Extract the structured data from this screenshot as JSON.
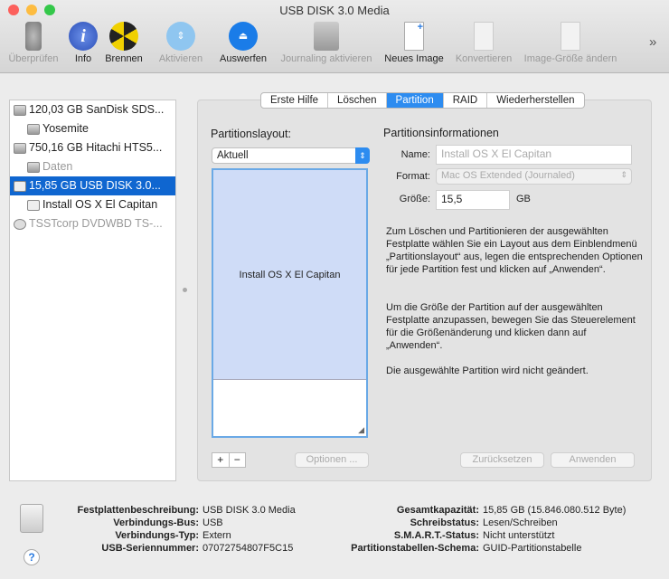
{
  "window": {
    "title": "USB DISK 3.0 Media"
  },
  "toolbar": {
    "items": [
      {
        "label": "Überprüfen",
        "icon": "microscope-icon",
        "enabled": false
      },
      {
        "label": "Info",
        "icon": "info-icon",
        "enabled": true
      },
      {
        "label": "Brennen",
        "icon": "burn-icon",
        "enabled": true
      },
      {
        "label": "Aktivieren",
        "icon": "mount-icon",
        "enabled": false
      },
      {
        "label": "Auswerfen",
        "icon": "eject-icon",
        "enabled": true
      },
      {
        "label": "Journaling aktivieren",
        "icon": "journaling-icon",
        "enabled": false
      },
      {
        "label": "Neues Image",
        "icon": "new-image-icon",
        "enabled": true
      },
      {
        "label": "Konvertieren",
        "icon": "convert-icon",
        "enabled": false
      },
      {
        "label": "Image-Größe ändern",
        "icon": "resize-image-icon",
        "enabled": false
      }
    ],
    "overflow": "»"
  },
  "sidebar": {
    "items": [
      {
        "label": "120,03 GB SanDisk SDS...",
        "level": 0
      },
      {
        "label": "Yosemite",
        "level": 1
      },
      {
        "label": "750,16 GB Hitachi HTS5...",
        "level": 0
      },
      {
        "label": "Daten",
        "level": 1
      },
      {
        "label": "15,85 GB USB DISK 3.0...",
        "level": 0,
        "selected": true
      },
      {
        "label": "Install OS X El Capitan",
        "level": 1
      },
      {
        "label": "TSSTcorp DVDWBD TS-...",
        "level": 0
      }
    ]
  },
  "tabs": [
    "Erste Hilfe",
    "Löschen",
    "Partition",
    "RAID",
    "Wiederherstellen"
  ],
  "active_tab": "Partition",
  "partition": {
    "layout_label": "Partitionslayout:",
    "layout_value": "Aktuell",
    "partition_name": "Install OS X El Capitan",
    "add": "+",
    "remove": "−",
    "options": "Optionen ...",
    "info_title": "Partitionsinformationen",
    "name_label": "Name:",
    "name_value": "Install OS X El Capitan",
    "format_label": "Format:",
    "format_value": "Mac OS Extended (Journaled)",
    "size_label": "Größe:",
    "size_value": "15,5",
    "size_unit": "GB",
    "help1": "Zum Löschen und Partitionieren der ausgewählten Festplatte wählen Sie ein Layout aus dem Einblendmenü „Partitionslayout“ aus, legen die entsprechenden Optionen für jede Partition fest und klicken auf „Anwenden“.",
    "help2": "Um die Größe der Partition auf der ausgewählten Festplatte anzupassen, bewegen Sie das Steuerelement für die Größenänderung und klicken dann auf „Anwenden“.",
    "help3": "Die ausgewählte Partition wird nicht geändert.",
    "revert": "Zurücksetzen",
    "apply": "Anwenden"
  },
  "info": {
    "left": [
      {
        "k": "Festplattenbeschreibung:",
        "v": "USB DISK 3.0 Media"
      },
      {
        "k": "Verbindungs-Bus:",
        "v": "USB"
      },
      {
        "k": "Verbindungs-Typ:",
        "v": "Extern"
      },
      {
        "k": "USB-Seriennummer:",
        "v": "07072754807F5C15"
      }
    ],
    "right": [
      {
        "k": "Gesamtkapazität:",
        "v": "15,85 GB (15.846.080.512 Byte)"
      },
      {
        "k": "Schreibstatus:",
        "v": "Lesen/Schreiben"
      },
      {
        "k": "S.M.A.R.T.-Status:",
        "v": "Nicht unterstützt"
      },
      {
        "k": "Partitionstabellen-Schema:",
        "v": "GUID-Partitionstabelle"
      }
    ],
    "help": "?"
  }
}
